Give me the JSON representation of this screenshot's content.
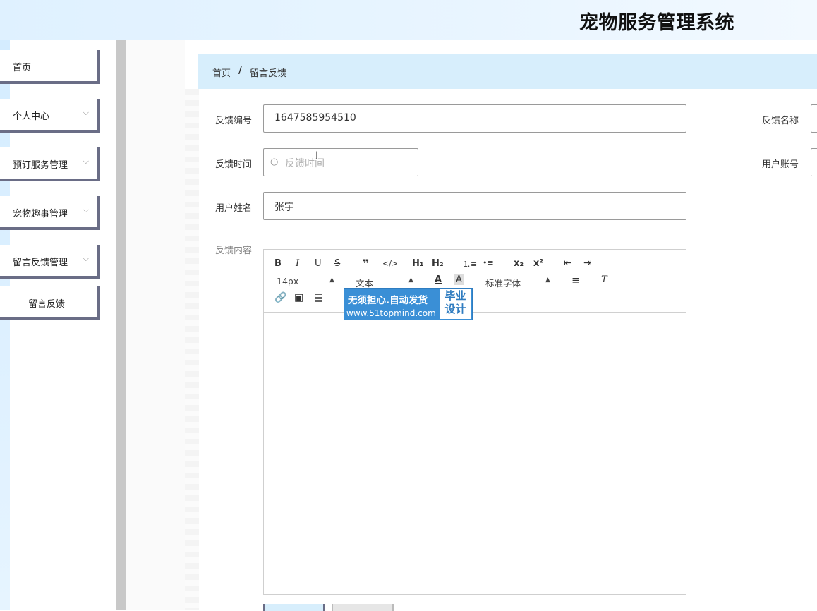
{
  "header": {
    "title": "宠物服务管理系统"
  },
  "sidebar": {
    "items": [
      {
        "label": "首页",
        "has_children": false
      },
      {
        "label": "个人中心",
        "has_children": true
      },
      {
        "label": "预订服务管理",
        "has_children": true
      },
      {
        "label": "宠物趣事管理",
        "has_children": true
      },
      {
        "label": "留言反馈管理",
        "has_children": true
      },
      {
        "label": "留言反馈",
        "has_children": false
      }
    ],
    "chevron": "⌵"
  },
  "breadcrumb": {
    "home": "首页",
    "separator": "/",
    "current": "留言反馈"
  },
  "form": {
    "feedback_no": {
      "label": "反馈编号",
      "value": "1647585954510"
    },
    "feedback_name": {
      "label": "反馈名称",
      "value": ""
    },
    "feedback_time": {
      "label": "反馈时间",
      "placeholder": "反馈时间"
    },
    "user_account": {
      "label": "用户账号",
      "value": ""
    },
    "user_name": {
      "label": "用户姓名",
      "value": "张宇"
    },
    "feedback_content": {
      "label": "反馈内容",
      "value": ""
    }
  },
  "editor": {
    "toolbar_row1": [
      "B",
      "I",
      "U",
      "S",
      "❞",
      "</>",
      "H₁",
      "H₂",
      "⒈≡",
      "•≡",
      "x₂",
      "x²",
      "⇤",
      "⇥"
    ],
    "size_select": "14px",
    "block_select": "文本",
    "font_select": "标准字体",
    "icons": [
      "bold-icon",
      "italic-icon",
      "underline-icon",
      "strike-icon",
      "quote-icon",
      "code-icon",
      "h1-icon",
      "h2-icon",
      "ordered-list-icon",
      "bullet-list-icon",
      "subscript-icon",
      "superscript-icon",
      "outdent-icon",
      "indent-icon",
      "font-color-icon",
      "background-color-icon",
      "align-icon",
      "clear-format-icon",
      "link-icon",
      "image-icon",
      "video-icon"
    ]
  },
  "watermark": {
    "line1": "无须担心.自动发货",
    "line2": "www.51topmind.com",
    "badge_top": "毕业",
    "badge_bottom": "设计"
  },
  "colors": {
    "header_bg": "#dff1ff",
    "breadcrumb_bg": "#d7eefc",
    "menu_border": "#6a6d86",
    "watermark_bg": "#3a8fd6"
  }
}
